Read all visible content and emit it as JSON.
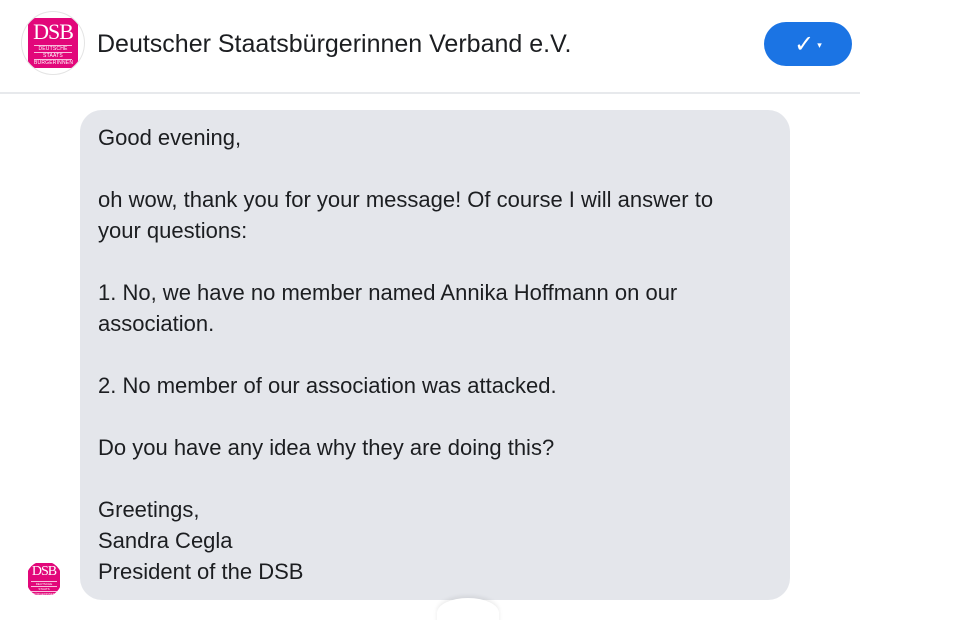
{
  "header": {
    "page_name": "Deutscher Staatsbürgerinnen Verband e.V.",
    "logo": {
      "letters": "DSB",
      "lines": [
        "Deutsche",
        "Staats",
        "Bürgerinnen"
      ]
    },
    "follow_button": {
      "check_icon": "✓",
      "caret_icon": "▾"
    }
  },
  "message": {
    "paragraphs": [
      [
        "Good evening,"
      ],
      [
        "oh wow, thank you for your message! Of course I will answer to",
        "your questions:"
      ],
      [
        "1. No, we have no member named Annika Hoffmann on our",
        "association."
      ],
      [
        "2. No member of our association was attacked."
      ],
      [
        "Do you have any idea why they are doing this?"
      ],
      [
        "Greetings,",
        "Sandra Cegla",
        "President of the DSB"
      ]
    ]
  },
  "sender_avatar": {
    "letters": "DSB",
    "lines": [
      "Deutsche",
      "Staats",
      "Bürgerinnen"
    ]
  },
  "colors": {
    "brand_pink": "#e2077a",
    "accent_blue": "#1b74e4",
    "bubble_gray": "#e4e6eb"
  },
  "icons": [
    "check-icon",
    "chevron-down-icon"
  ]
}
